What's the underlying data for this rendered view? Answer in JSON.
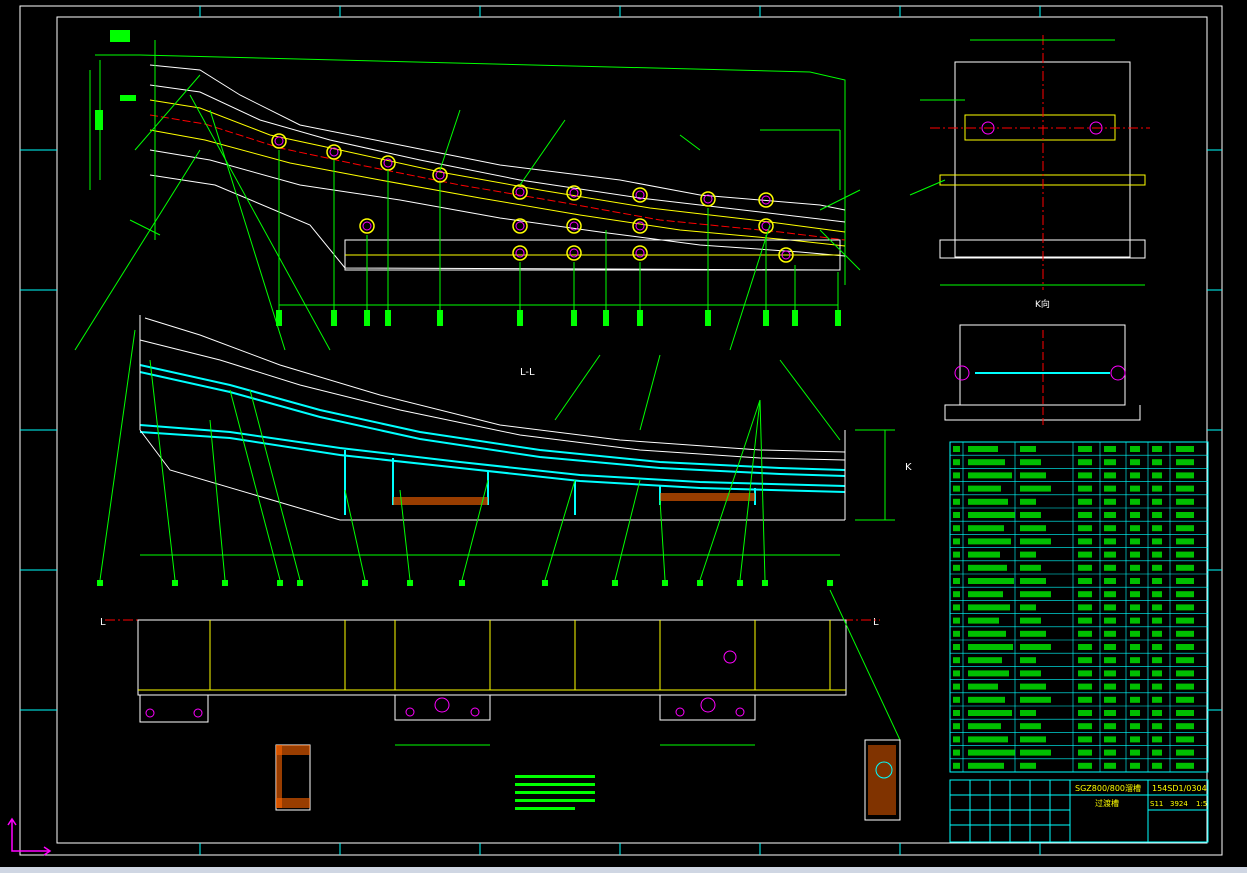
{
  "drawing": {
    "background": "#000000",
    "colors": {
      "frame": "#ffffff",
      "border": "#00ffff",
      "geometry": "#ffffff",
      "dimension": "#00ff00",
      "center": "#ff0000",
      "hidden": "#ffff00",
      "hatch": "#00ffff",
      "holes": "#ff00ff"
    },
    "section_labels": {
      "section_ll": "L-L",
      "section_k": "K",
      "view_k": "K向",
      "left_l": "L",
      "right_l": "L"
    },
    "title_block": {
      "model": "SGZ800/800溜槽",
      "drawing_no": "154SD1/0304",
      "part_name": "过渡槽",
      "scale": "1:5",
      "sheet": "S11",
      "weight": "3924"
    },
    "icons": {
      "ucs": "ucs-axis-icon"
    }
  }
}
